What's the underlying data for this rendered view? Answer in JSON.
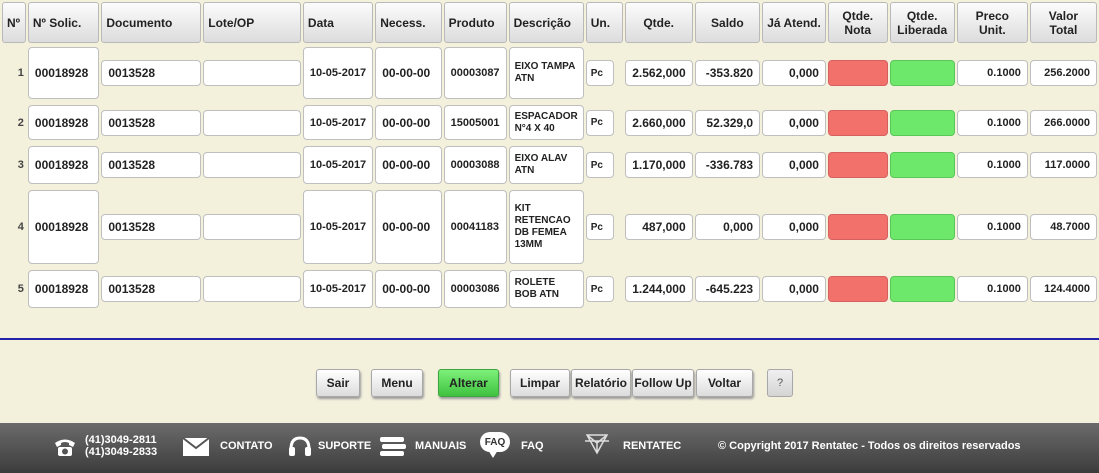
{
  "columns": [
    "Nº",
    "Nº Solic.",
    "Documento",
    "Lote/OP",
    "Data",
    "Necess.",
    "Produto",
    "Descrição",
    "Un.",
    "Qtde.",
    "Saldo",
    "Já Atend.",
    "Qtde. Nota",
    "Qtde. Liberada",
    "Preco Unit.",
    "Valor Total"
  ],
  "rows": [
    {
      "n": "1",
      "solic": "00018928",
      "documento": "0013528",
      "lote": "",
      "data": "10-05-2017",
      "necess": "00-00-00",
      "produto": "00003087",
      "descricao": "EIXO TAMPA ATN",
      "un": "Pc",
      "qtde": "2.562,000",
      "saldo": "-353.820",
      "ja_atend": "0,000",
      "preco": "0.1000",
      "valor": "256.2000"
    },
    {
      "n": "2",
      "solic": "00018928",
      "documento": "0013528",
      "lote": "",
      "data": "10-05-2017",
      "necess": "00-00-00",
      "produto": "15005001",
      "descricao": "ESPACADOR N°4 X 40",
      "un": "Pc",
      "qtde": "2.660,000",
      "saldo": "52.329,0",
      "ja_atend": "0,000",
      "preco": "0.1000",
      "valor": "266.0000"
    },
    {
      "n": "3",
      "solic": "00018928",
      "documento": "0013528",
      "lote": "",
      "data": "10-05-2017",
      "necess": "00-00-00",
      "produto": "00003088",
      "descricao": "EIXO ALAV ATN",
      "un": "Pc",
      "qtde": "1.170,000",
      "saldo": "-336.783",
      "ja_atend": "0,000",
      "preco": "0.1000",
      "valor": "117.0000"
    },
    {
      "n": "4",
      "solic": "00018928",
      "documento": "0013528",
      "lote": "",
      "data": "10-05-2017",
      "necess": "00-00-00",
      "produto": "00041183",
      "descricao": "KIT RETENCAO DB FEMEA 13MM",
      "un": "Pc",
      "qtde": "487,000",
      "saldo": "0,000",
      "ja_atend": "0,000",
      "preco": "0.1000",
      "valor": "48.7000"
    },
    {
      "n": "5",
      "solic": "00018928",
      "documento": "0013528",
      "lote": "",
      "data": "10-05-2017",
      "necess": "00-00-00",
      "produto": "00003086",
      "descricao": "ROLETE BOB ATN",
      "un": "Pc",
      "qtde": "1.244,000",
      "saldo": "-645.223",
      "ja_atend": "0,000",
      "preco": "0.1000",
      "valor": "124.4000"
    }
  ],
  "status_colors": {
    "nota": "#f2716b",
    "liberada": "#6ee86a"
  },
  "buttons": {
    "sair": "Sair",
    "menu": "Menu",
    "alterar": "Alterar",
    "limpar": "Limpar",
    "relatorio": "Relatório",
    "follow_up": "Follow Up",
    "voltar": "Voltar",
    "help": "?"
  },
  "footer": {
    "phone1": "(41)3049-2811",
    "phone2": "(41)3049-2833",
    "contato": "CONTATO",
    "suporte": "SUPORTE",
    "manuais": "MANUAIS",
    "faq_icon": "FAQ",
    "faq": "FAQ",
    "rentatec": "RENTATEC",
    "copyright": "© Copyright 2017 Rentatec - Todos os direitos reservados"
  },
  "icons": {
    "phone": "phone-icon",
    "mail": "mail-icon",
    "headset": "headset-icon",
    "books": "books-icon",
    "faq": "faq-bubble-icon",
    "logo": "rentatec-logo-icon"
  }
}
